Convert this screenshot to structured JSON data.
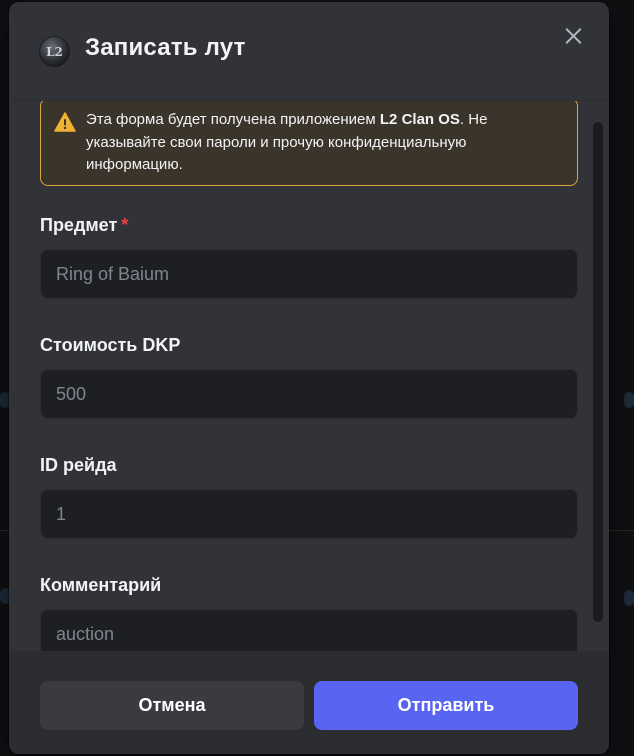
{
  "modal": {
    "title": "Записать лут",
    "app_icon_text": "L2",
    "close_icon": "close-icon"
  },
  "notice": {
    "icon": "warning-icon",
    "text_before": "Эта форма будет получена приложением ",
    "app_name": "L2 Clan OS",
    "text_after": ". Не указывайте свои пароли и прочую конфиденциальную информацию."
  },
  "fields": [
    {
      "label": "Предмет",
      "required": "*",
      "placeholder": "Ring of Baium",
      "value": ""
    },
    {
      "label": "Стоимость DKP",
      "placeholder": "500",
      "value": ""
    },
    {
      "label": "ID рейда",
      "placeholder": "1",
      "value": ""
    },
    {
      "label": "Комментарий",
      "placeholder": "auction",
      "value": ""
    }
  ],
  "footer": {
    "cancel_label": "Отмена",
    "submit_label": "Отправить"
  },
  "colors": {
    "modal_bg": "#313338",
    "input_bg": "#1e1f22",
    "notice_border": "#d9a63b",
    "notice_bg": "#3b342a",
    "required": "#f23f43",
    "primary": "#5865f2"
  }
}
